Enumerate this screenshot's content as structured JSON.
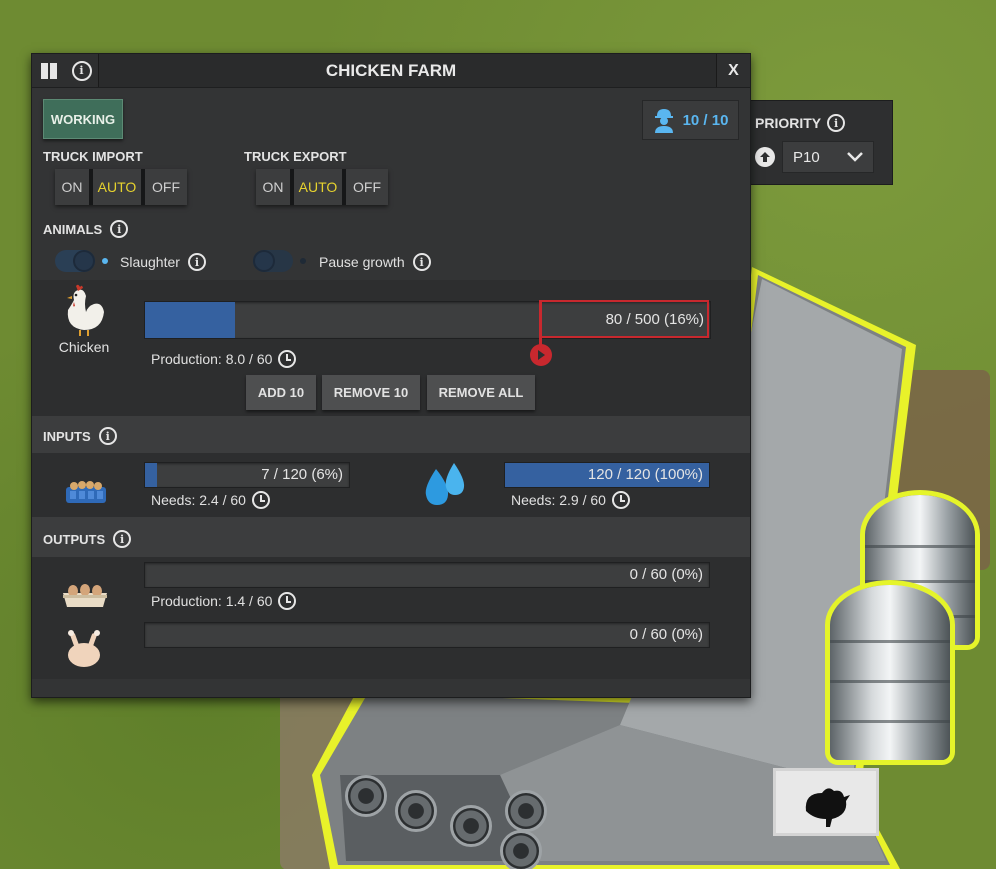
{
  "window": {
    "title": "CHICKEN FARM",
    "close_label": "X"
  },
  "status": {
    "label": "WORKING",
    "color": "#3f6e5a"
  },
  "workers": {
    "value": "10 / 10"
  },
  "priority": {
    "label": "PRIORITY",
    "selected": "P10"
  },
  "truck_import": {
    "label": "TRUCK IMPORT",
    "options": [
      "ON",
      "AUTO",
      "OFF"
    ],
    "selected": "AUTO"
  },
  "truck_export": {
    "label": "TRUCK EXPORT",
    "options": [
      "ON",
      "AUTO",
      "OFF"
    ],
    "selected": "AUTO"
  },
  "animals": {
    "label": "ANIMALS",
    "slaughter": {
      "label": "Slaughter",
      "enabled": true
    },
    "pause_growth": {
      "label": "Pause growth",
      "enabled": false
    },
    "chicken": {
      "name": "Chicken",
      "value_text": "80 / 500 (16%)",
      "fraction": 0.16,
      "production": "Production: 8.0 / 60"
    },
    "buttons": {
      "add": "ADD 10",
      "remove": "REMOVE 10",
      "remove_all": "REMOVE ALL"
    }
  },
  "inputs": {
    "label": "INPUTS",
    "feed": {
      "value_text": "7 / 120 (6%)",
      "fraction": 0.06,
      "needs": "Needs: 2.4 / 60"
    },
    "water": {
      "value_text": "120 / 120 (100%)",
      "fraction": 1.0,
      "needs": "Needs: 2.9 / 60"
    }
  },
  "outputs": {
    "label": "OUTPUTS",
    "eggs": {
      "value_text": "0 / 60 (0%)",
      "fraction": 0,
      "production": "Production: 1.4 / 60"
    },
    "meat": {
      "value_text": "0 / 60 (0%)",
      "fraction": 0
    }
  },
  "colors": {
    "accent_blue": "#3561a0",
    "active_yellow": "#e6d22e",
    "workers_blue": "#5ab6f0"
  }
}
